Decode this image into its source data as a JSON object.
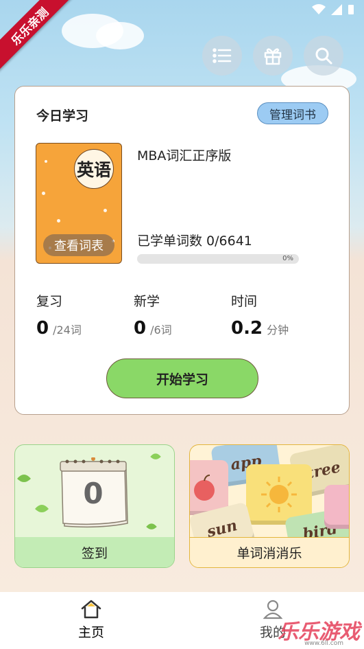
{
  "corner_badge": "乐乐亲测",
  "top_buttons": [
    {
      "icon": "list-icon"
    },
    {
      "icon": "gift-icon"
    },
    {
      "icon": "search-icon"
    }
  ],
  "card": {
    "title": "今日学习",
    "manage_label": "管理词书",
    "book": {
      "cover_text": "英语",
      "view_list_label": "查看词表",
      "name": "MBA词汇正序版",
      "learned_text": "已学单词数 0/6641",
      "progress_label": "0%",
      "progress": 0
    },
    "stats": [
      {
        "label": "复习",
        "value": "0",
        "unit": "/24词"
      },
      {
        "label": "新学",
        "value": "0",
        "unit": "/6词"
      },
      {
        "label": "时间",
        "value": "0.2",
        "unit": "分钟"
      }
    ],
    "start_label": "开始学习"
  },
  "tiles": {
    "checkin": {
      "label": "签到",
      "calendar_number": "0"
    },
    "game": {
      "label": "单词消消乐",
      "words": [
        "app",
        "tree",
        "sun",
        "bird"
      ]
    }
  },
  "nav": {
    "home_label": "主页",
    "mine_label": "我的"
  },
  "watermark": {
    "text": "乐乐游戏",
    "sub": "www.6ll.com"
  },
  "colors": {
    "accent_green": "#8ad867",
    "manage_blue": "#9ccbf3",
    "book_orange": "#f6a43a"
  }
}
